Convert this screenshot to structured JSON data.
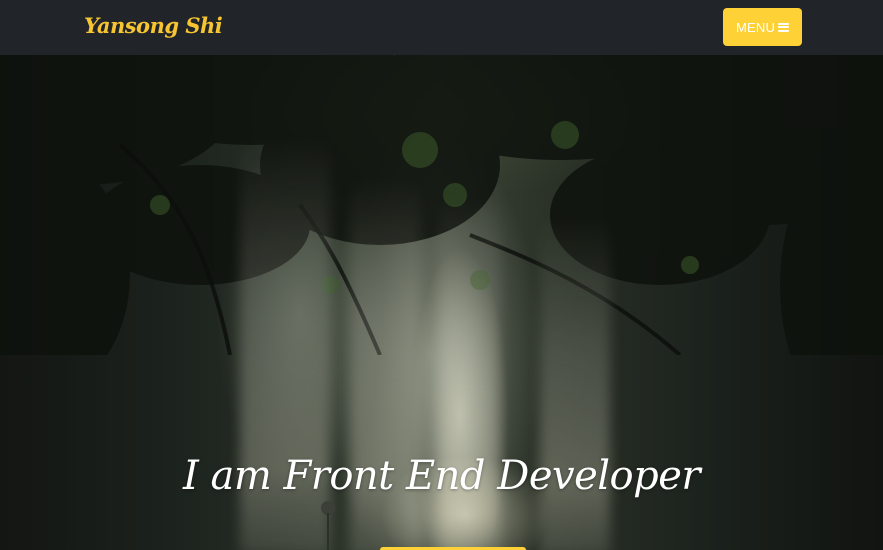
{
  "navbar": {
    "brand": "Yansong Shi",
    "menu_label": "MENU",
    "menu_icon": "bars-icon"
  },
  "hero": {
    "headline": "I am Front End Developer",
    "background": "forest-path-with-light-rays-photo"
  },
  "colors": {
    "accent": "#fed136",
    "brand_text": "#f7c531",
    "navbar_bg": "#212428",
    "headline_text": "#ffffff"
  }
}
